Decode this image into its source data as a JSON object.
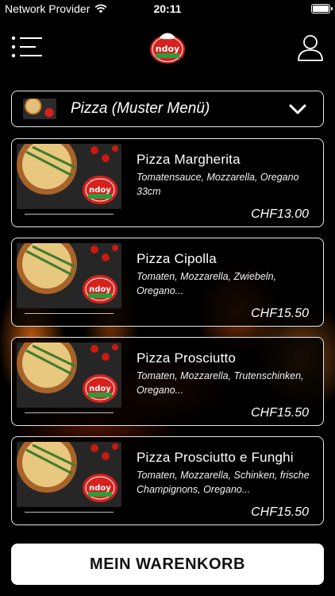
{
  "status_bar": {
    "carrier": "Network Provider",
    "time": "20:11"
  },
  "header": {
    "logo_text": "ndoy",
    "menu_icon": "list-menu-icon",
    "user_icon": "user-profile-icon"
  },
  "category": {
    "label": "Pizza (Muster Menü)",
    "chevron_icon": "chevron-down-icon"
  },
  "products": [
    {
      "name": "Pizza Margherita",
      "description": "Tomatensauce, Mozzarella, Oregano 33cm",
      "price": "CHF13.00"
    },
    {
      "name": "Pizza Cipolla",
      "description": "Tomaten, Mozzarella, Zwiebeln, Oregano...",
      "price": "CHF15.50"
    },
    {
      "name": "Pizza Prosciutto",
      "description": "Tomaten, Mozzarella, Trutenschinken, Oregano...",
      "price": "CHF15.50"
    },
    {
      "name": "Pizza Prosciutto e Funghi",
      "description": "Tomaten, Mozzarella, Schinken, frische Champignons, Oregano...",
      "price": "CHF15.50"
    }
  ],
  "cart": {
    "label": "MEIN WARENKORB"
  },
  "colors": {
    "background": "#000000",
    "border": "#e6e6e6",
    "logo_red": "#d6211c",
    "logo_green": "#2e9b3a"
  }
}
